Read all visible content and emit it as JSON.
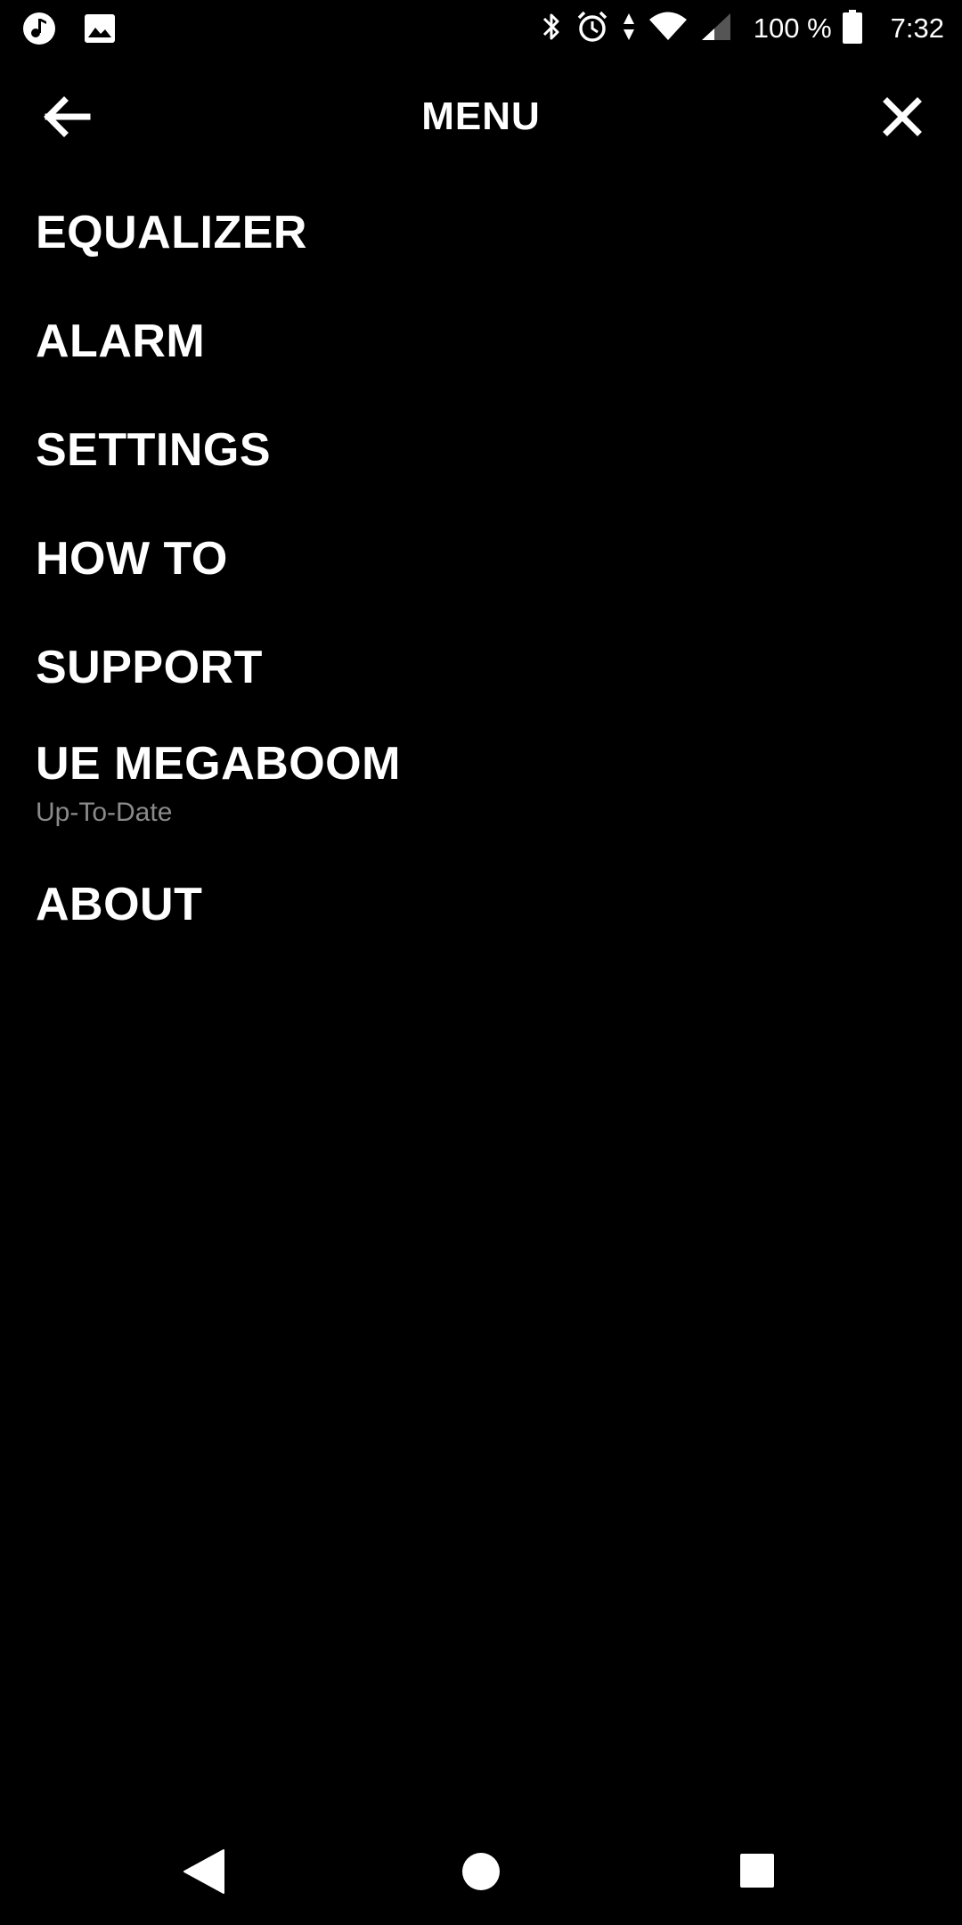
{
  "status_bar": {
    "icons_left": [
      "music-note-icon",
      "image-icon"
    ],
    "icons_right": [
      "bluetooth-icon",
      "alarm-clock-icon",
      "data-arrows-icon",
      "wifi-icon",
      "cell-signal-icon",
      "battery-icon"
    ],
    "battery_percent": "100 %",
    "time": "7:32"
  },
  "header": {
    "title": "MENU",
    "back_icon": "arrow-left-icon",
    "close_icon": "close-icon"
  },
  "menu": {
    "items": [
      {
        "label": "EQUALIZER"
      },
      {
        "label": "ALARM"
      },
      {
        "label": "SETTINGS"
      },
      {
        "label": "HOW TO"
      },
      {
        "label": "SUPPORT"
      },
      {
        "label": "UE MEGABOOM",
        "sublabel": "Up-To-Date"
      },
      {
        "label": "ABOUT"
      }
    ]
  },
  "nav_bar": {
    "back_icon": "triangle-back-icon",
    "home_icon": "circle-home-icon",
    "recents_icon": "square-recents-icon"
  },
  "colors": {
    "background": "#000000",
    "text": "#ffffff",
    "sublabel": "#8a8a8a"
  }
}
